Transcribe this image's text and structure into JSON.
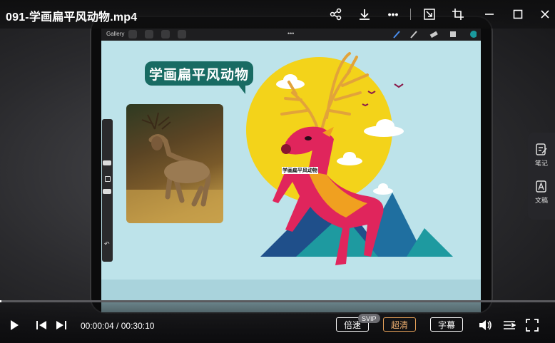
{
  "window": {
    "title": "091-学画扁平风动物.mp4"
  },
  "topbar": {
    "icons": [
      "share-icon",
      "download-icon",
      "more-icon",
      "pip-icon",
      "crop-icon",
      "minimize-icon",
      "maximize-icon",
      "close-icon"
    ]
  },
  "tablet": {
    "app_toolbar": {
      "gallery_label": "Gallery"
    },
    "canvas": {
      "heading": "学画扁平风动物",
      "deer_label": "学画扁平风动物",
      "colors": {
        "bg": "#bde3ea",
        "moon": "#f3d31a",
        "deer": "#e0255c",
        "antler": "#e2a33a",
        "mountain_dark": "#1f4f8a",
        "mountain_teal": "#1e9aa0",
        "bubble": "#186b63"
      }
    }
  },
  "sidepanel": {
    "items": [
      {
        "label": "笔记",
        "icon": "note-icon"
      },
      {
        "label": "文稿",
        "icon": "document-icon"
      }
    ]
  },
  "player": {
    "current_time": "00:00:04",
    "separator": " / ",
    "duration": "00:30:10",
    "speed_label": "倍速",
    "speed_badge": "SVIP",
    "quality_label": "超清",
    "subtitle_label": "字幕",
    "progress_fraction": 0.002
  }
}
